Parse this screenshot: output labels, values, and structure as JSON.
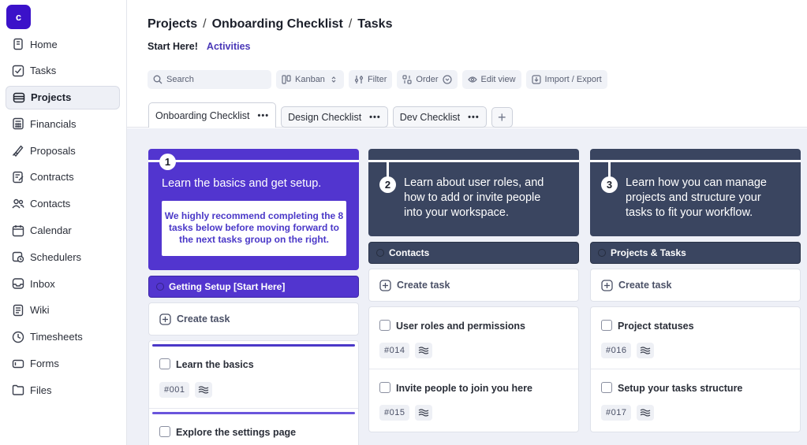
{
  "app": {
    "logo_letter": "c"
  },
  "sidebar": {
    "items": [
      {
        "label": "Home",
        "icon": "home-icon"
      },
      {
        "label": "Tasks",
        "icon": "tasks-icon"
      },
      {
        "label": "Projects",
        "icon": "projects-icon",
        "active": true
      },
      {
        "label": "Financials",
        "icon": "financials-icon"
      },
      {
        "label": "Proposals",
        "icon": "proposals-icon"
      },
      {
        "label": "Contracts",
        "icon": "contracts-icon"
      },
      {
        "label": "Contacts",
        "icon": "contacts-icon"
      },
      {
        "label": "Calendar",
        "icon": "calendar-icon"
      },
      {
        "label": "Schedulers",
        "icon": "schedulers-icon"
      },
      {
        "label": "Inbox",
        "icon": "inbox-icon"
      },
      {
        "label": "Wiki",
        "icon": "wiki-icon"
      },
      {
        "label": "Timesheets",
        "icon": "timesheets-icon"
      },
      {
        "label": "Forms",
        "icon": "forms-icon"
      },
      {
        "label": "Files",
        "icon": "files-icon"
      }
    ]
  },
  "header": {
    "breadcrumbs": [
      "Projects",
      "Onboarding Checklist",
      "Tasks"
    ],
    "subtabs": [
      "Start Here!",
      "Activities"
    ],
    "toolbar": {
      "search_placeholder": "Search",
      "view": "Kanban",
      "filter": "Filter",
      "order": "Order",
      "edit_view": "Edit view",
      "import_export": "Import / Export"
    },
    "checklist_tabs": [
      "Onboarding Checklist",
      "Design Checklist",
      "Dev Checklist"
    ],
    "dots": "•••"
  },
  "columns": [
    {
      "number": "1",
      "hero_title": "Learn the basics and get setup.",
      "hero_note": "We highly recommend completing the 8 tasks below before moving forward to the next tasks group on the right.",
      "group": "Getting Setup [Start Here]",
      "create_label": "Create task",
      "cards": [
        {
          "title": "Learn the basics",
          "id": "#001"
        },
        {
          "title": "Explore the settings page",
          "id": ""
        }
      ]
    },
    {
      "number": "2",
      "hero_title": "Learn about user roles, and how to add or invite people into your workspace.",
      "group": "Contacts",
      "create_label": "Create task",
      "cards": [
        {
          "title": "User roles and permissions",
          "id": "#014"
        },
        {
          "title": "Invite people to join you here",
          "id": "#015"
        }
      ]
    },
    {
      "number": "3",
      "hero_title": "Learn how you can manage projects and structure your tasks to fit your workflow.",
      "group": "Projects & Tasks",
      "create_label": "Create task",
      "cards": [
        {
          "title": "Project statuses",
          "id": "#016"
        },
        {
          "title": "Setup your tasks structure",
          "id": "#017"
        }
      ]
    }
  ],
  "colors": {
    "accent": "#5235cf",
    "slate": "#3a4560",
    "logo": "#3b12c9"
  }
}
